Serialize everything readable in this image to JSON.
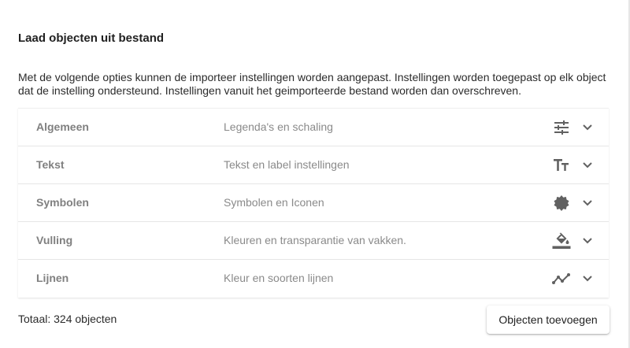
{
  "dialog": {
    "title": "Laad objecten uit bestand",
    "description": "Met de volgende opties kunnen de importeer instellingen worden aangepast. Instellingen worden toegepast op elk object dat de instelling ondersteund. Instellingen vanuit het geimporteerde bestand worden dan overschreven."
  },
  "panels": [
    {
      "label": "Algemeen",
      "description": "Legenda's en schaling",
      "icon": "tune-icon"
    },
    {
      "label": "Tekst",
      "description": "Tekst en label instellingen",
      "icon": "text-fields-icon"
    },
    {
      "label": "Symbolen",
      "description": "Symbolen en Iconen",
      "icon": "starburst-icon"
    },
    {
      "label": "Vulling",
      "description": "Kleuren en transparantie van vakken.",
      "icon": "format-color-fill-icon"
    },
    {
      "label": "Lijnen",
      "description": "Kleur en soorten lijnen",
      "icon": "timeline-icon"
    }
  ],
  "footer": {
    "total": "Totaal: 324 objecten",
    "add_button": "Objecten toevoegen"
  },
  "colors": {
    "icon": "#616161",
    "panel_label": "#808080",
    "panel_desc": "#8a8a8a"
  }
}
